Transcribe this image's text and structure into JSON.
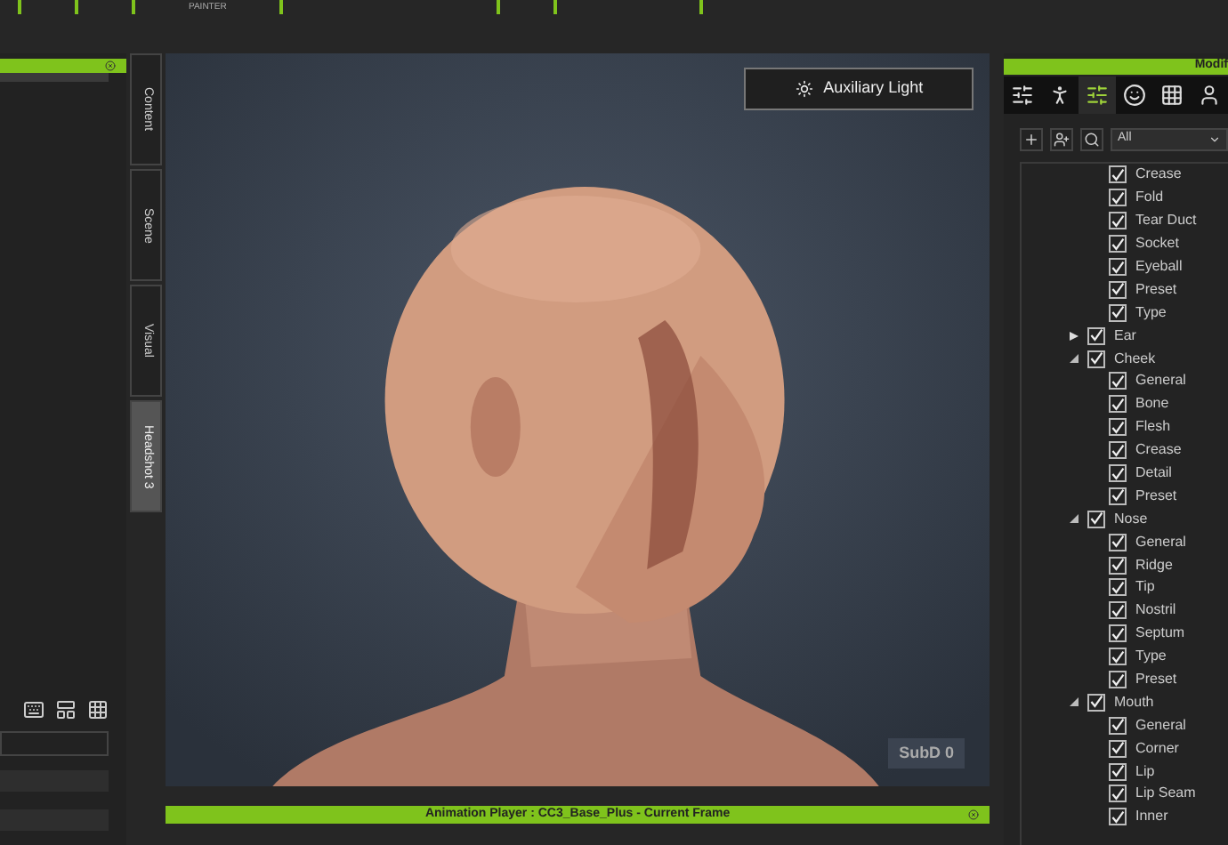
{
  "toolbar": {
    "painter_label": "PAINTER"
  },
  "side_tabs": [
    {
      "label": "Content",
      "selected": false
    },
    {
      "label": "Scene",
      "selected": false
    },
    {
      "label": "Visual",
      "selected": false
    },
    {
      "label": "Headshot 3",
      "selected": true
    }
  ],
  "viewport": {
    "light_button": "Auxiliary Light",
    "subd_label": "SubD 0"
  },
  "animation_player": {
    "title": "Animation Player : CC3_Base_Plus - Current Frame"
  },
  "modify_panel": {
    "title": "Modif",
    "tabs": [
      {
        "kind": "sliders",
        "selected": false
      },
      {
        "kind": "pose",
        "selected": false
      },
      {
        "kind": "morph",
        "selected": true
      },
      {
        "kind": "face",
        "selected": false
      },
      {
        "kind": "texture",
        "selected": false
      },
      {
        "kind": "head",
        "selected": false
      }
    ],
    "filter": "All",
    "tree": [
      {
        "children": [
          {
            "label": "Crease",
            "checked": true
          },
          {
            "label": "Fold",
            "checked": true
          },
          {
            "label": "Tear Duct",
            "checked": true
          },
          {
            "label": "Socket",
            "checked": true
          },
          {
            "label": "Eyeball",
            "checked": true
          },
          {
            "label": "Preset",
            "checked": true
          },
          {
            "label": "Type",
            "checked": true
          }
        ]
      },
      {
        "label": "Ear",
        "checked": true,
        "expanded": false
      },
      {
        "label": "Cheek",
        "checked": true,
        "expanded": true,
        "children": [
          {
            "label": "General",
            "checked": true
          },
          {
            "label": "Bone",
            "checked": true
          },
          {
            "label": "Flesh",
            "checked": true
          },
          {
            "label": "Crease",
            "checked": true
          },
          {
            "label": "Detail",
            "checked": true
          },
          {
            "label": "Preset",
            "checked": true
          }
        ]
      },
      {
        "label": "Nose",
        "checked": true,
        "expanded": true,
        "children": [
          {
            "label": "General",
            "checked": true
          },
          {
            "label": "Ridge",
            "checked": true
          },
          {
            "label": "Tip",
            "checked": true
          },
          {
            "label": "Nostril",
            "checked": true
          },
          {
            "label": "Septum",
            "checked": true
          },
          {
            "label": "Type",
            "checked": true
          },
          {
            "label": "Preset",
            "checked": true
          }
        ]
      },
      {
        "label": "Mouth",
        "checked": true,
        "expanded": true,
        "children": [
          {
            "label": "General",
            "checked": true
          },
          {
            "label": "Corner",
            "checked": true
          },
          {
            "label": "Lip",
            "checked": true
          },
          {
            "label": "Lip Seam",
            "checked": true
          },
          {
            "label": "Inner",
            "checked": true
          }
        ]
      }
    ]
  }
}
